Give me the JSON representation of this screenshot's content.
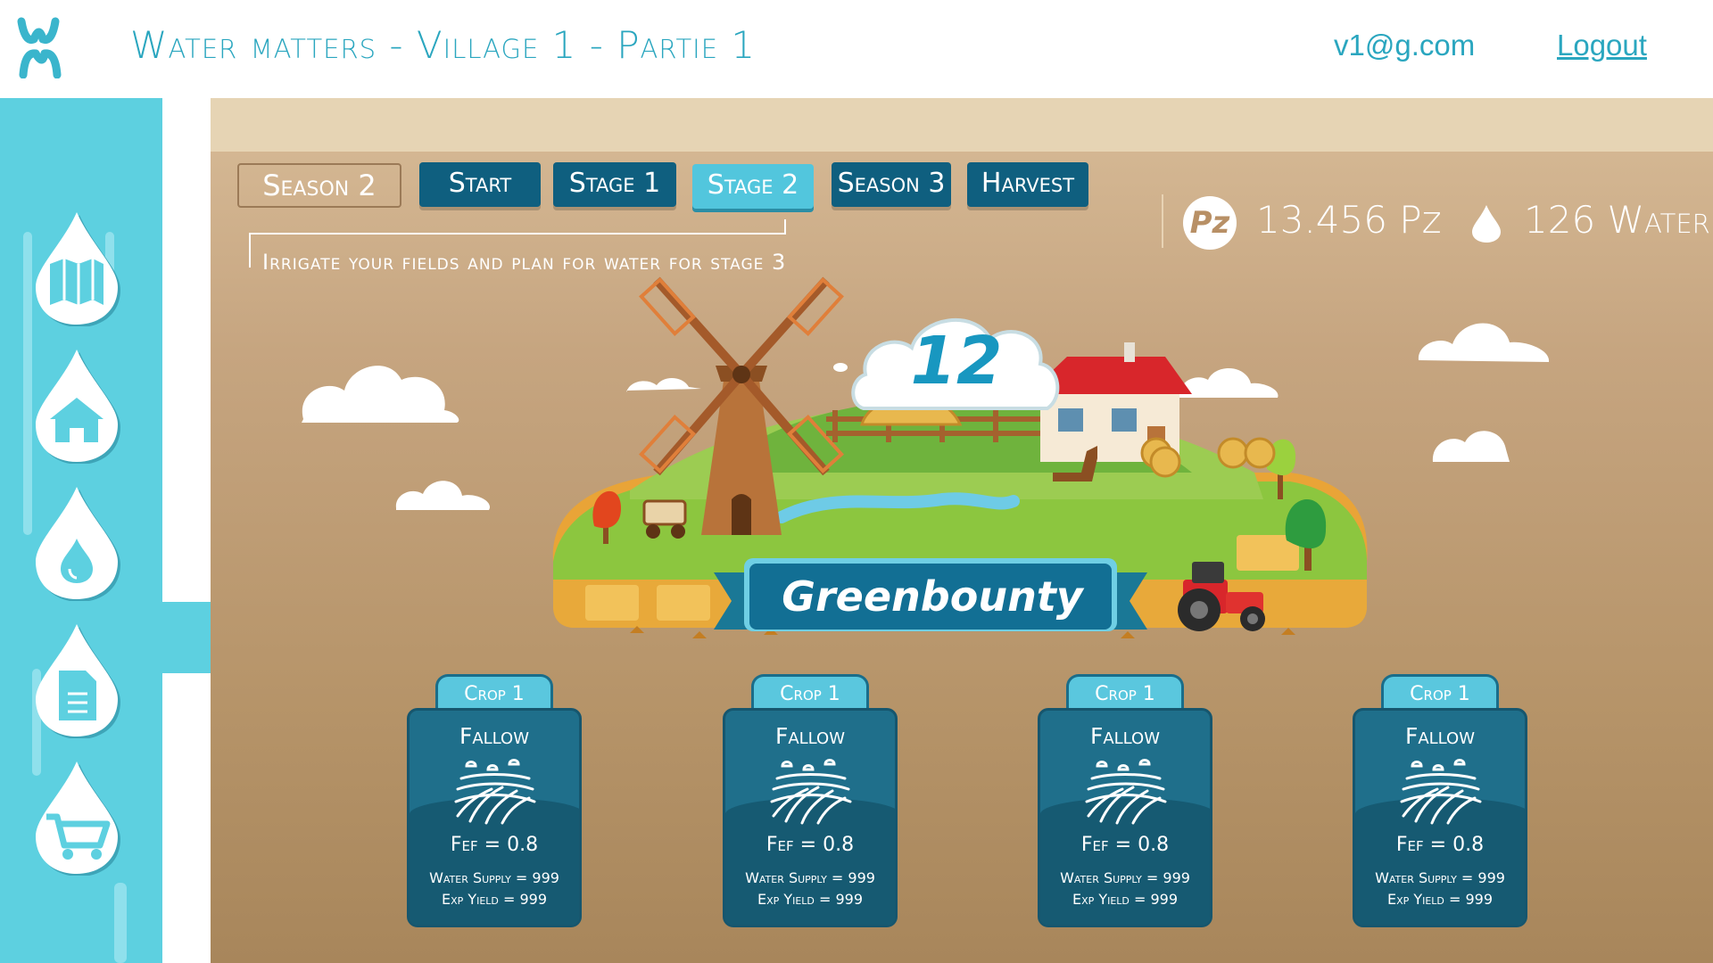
{
  "header": {
    "logo_text": "WM",
    "title": "Water matters - Village 1 - Partie 1",
    "user_email": "v1@g.com",
    "logout_label": "Logout"
  },
  "sidebar": {
    "items": [
      {
        "icon": "map-icon"
      },
      {
        "icon": "home-icon"
      },
      {
        "icon": "water-drop-icon"
      },
      {
        "icon": "document-icon"
      },
      {
        "icon": "cart-icon"
      }
    ]
  },
  "stage_nav": {
    "season_label": "Season 2",
    "tabs": [
      {
        "label": "Start"
      },
      {
        "label": "Stage 1"
      },
      {
        "label": "Stage 2"
      },
      {
        "label": "Season 3"
      },
      {
        "label": "Harvest"
      }
    ],
    "active_tab": "Stage 2",
    "instruction": "Irrigate your fields and plan for water for stage 3"
  },
  "resources": {
    "pz_icon_label": "Pz",
    "pz_value": "13.456 Pz",
    "water_value": "126 Water"
  },
  "village": {
    "round_number": "12",
    "name": "Greenbounty"
  },
  "crops": [
    {
      "tab": "Crop 1",
      "status": "Fallow",
      "fef": "Fef = 0.8",
      "water_supply": "Water Supply = 999",
      "exp_yield": "Exp Yield = 999"
    },
    {
      "tab": "Crop 1",
      "status": "Fallow",
      "fef": "Fef = 0.8",
      "water_supply": "Water Supply = 999",
      "exp_yield": "Exp Yield = 999"
    },
    {
      "tab": "Crop 1",
      "status": "Fallow",
      "fef": "Fef = 0.8",
      "water_supply": "Water Supply = 999",
      "exp_yield": "Exp Yield = 999"
    },
    {
      "tab": "Crop 1",
      "status": "Fallow",
      "fef": "Fef = 0.8",
      "water_supply": "Water Supply = 999",
      "exp_yield": "Exp Yield = 999"
    }
  ],
  "colors": {
    "accent": "#2aa6bf",
    "sidebar": "#5dd0e0",
    "tab_dark": "#0f5f7f",
    "tab_active": "#52c6dd",
    "card": "#1f6f8b"
  }
}
